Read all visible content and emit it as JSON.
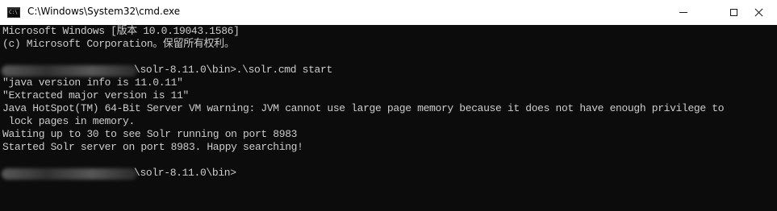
{
  "window": {
    "title": "C:\\Windows\\System32\\cmd.exe",
    "icon_text": "C:\\"
  },
  "controls": {
    "minimize": "minimize",
    "maximize": "maximize",
    "close": "close"
  },
  "console": {
    "lines": [
      "Microsoft Windows [版本 10.0.19043.1586]",
      "(c) Microsoft Corporation。保留所有权利。",
      "",
      "\\solr-8.11.0\\bin>.\\solr.cmd start",
      "\"java version info is 11.0.11\"",
      "\"Extracted major version is 11\"",
      "Java HotSpot(TM) 64-Bit Server VM warning: JVM cannot use large page memory because it does not have enough privilege to",
      " lock pages in memory.",
      "Waiting up to 30 to see Solr running on port 8983",
      "Started Solr server on port 8983. Happy searching!",
      "",
      "\\solr-8.11.0\\bin>"
    ]
  },
  "colors": {
    "console_bg": "#0c0c0c",
    "console_fg": "#cccccc",
    "titlebar_bg": "#ffffff"
  }
}
